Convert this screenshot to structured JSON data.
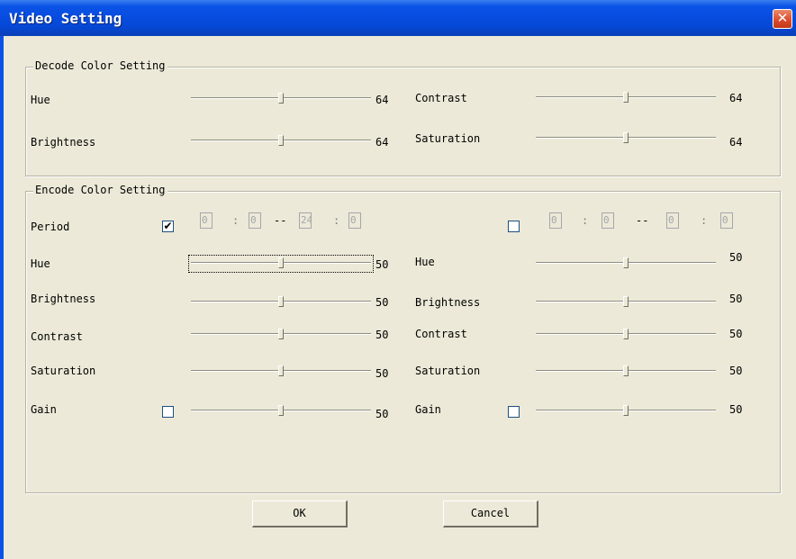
{
  "window": {
    "title": "Video Setting",
    "close_glyph": "✕"
  },
  "decode": {
    "legend": "Decode Color Setting",
    "items": [
      {
        "label": "Hue",
        "value": "64",
        "level": 0.5
      },
      {
        "label": "Brightness",
        "value": "64",
        "level": 0.5
      },
      {
        "label": "Contrast",
        "value": "64",
        "level": 0.5
      },
      {
        "label": "Saturation",
        "value": "64",
        "level": 0.5
      }
    ]
  },
  "encode": {
    "legend": "Encode Color Setting",
    "period_label": "Period",
    "period1": {
      "checked": true,
      "check_glyph": "✔",
      "start_h": "0",
      "start_m": "0",
      "end_h": "24",
      "end_m": "0"
    },
    "period2": {
      "checked": false,
      "check_glyph": "",
      "start_h": "0",
      "start_m": "0",
      "end_h": "0",
      "end_m": "0"
    },
    "colon": ":",
    "dash": "--",
    "left": [
      {
        "label": "Hue",
        "value": "50",
        "level": 0.5
      },
      {
        "label": "Brightness",
        "value": "50",
        "level": 0.5
      },
      {
        "label": "Contrast",
        "value": "50",
        "level": 0.5
      },
      {
        "label": "Saturation",
        "value": "50",
        "level": 0.5
      },
      {
        "label": "Gain",
        "value": "50",
        "level": 0.5
      }
    ],
    "right": [
      {
        "label": "Hue",
        "value": "50",
        "level": 0.5
      },
      {
        "label": "Brightness",
        "value": "50",
        "level": 0.5
      },
      {
        "label": "Contrast",
        "value": "50",
        "level": 0.5
      },
      {
        "label": "Saturation",
        "value": "50",
        "level": 0.5
      },
      {
        "label": "Gain",
        "value": "50",
        "level": 0.5
      }
    ],
    "gain_left_checked": false,
    "gain_right_checked": false
  },
  "buttons": {
    "ok": "OK",
    "cancel": "Cancel"
  }
}
